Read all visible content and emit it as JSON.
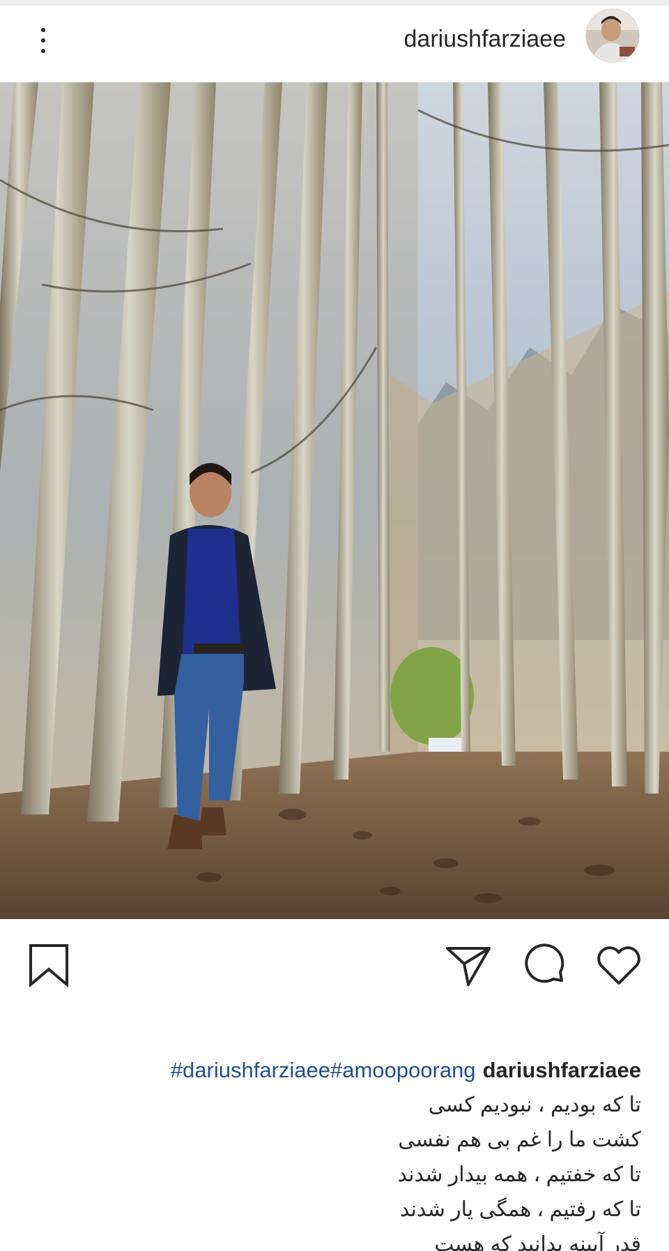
{
  "header": {
    "username": "dariushfarziaee",
    "more_icon": "more-vertical-icon",
    "avatar_icon": "profile-avatar"
  },
  "post": {
    "image_alt": "",
    "actions": {
      "like_icon": "heart-icon",
      "comment_icon": "comment-icon",
      "share_icon": "share-icon",
      "save_icon": "bookmark-icon"
    }
  },
  "caption": {
    "username": "dariushfarziaee",
    "hashtags": "#dariushfarziaee#amoopoorang",
    "lines": [
      "تا که بودیم ، نبودیم کسی",
      "کشت ما را غم بی هم نفسی",
      "تا که خفتیم ، همه بیدار شدند",
      "تا که رفتیم ، همگی یار شدند",
      "قدر آیینه بدانید که هست"
    ]
  },
  "colors": {
    "text": "#262626",
    "hashtag": "#1f4f8f",
    "background": "#ffffff"
  }
}
